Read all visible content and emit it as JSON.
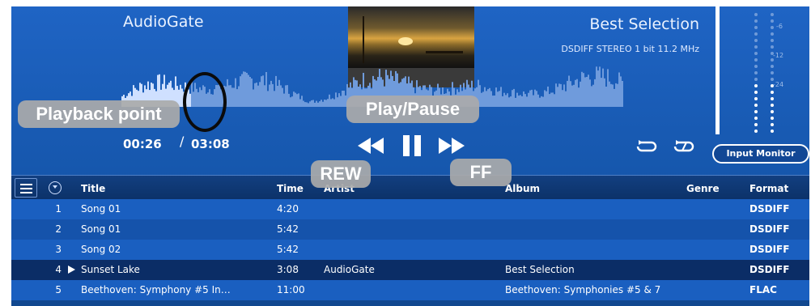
{
  "player": {
    "app_name": "AudioGate",
    "album_title": "Best Selection",
    "format_info": "DSDIFF STEREO 1 bit 11.2 MHz",
    "time_current": "00:26",
    "time_separator": "/",
    "time_total": "03:08",
    "input_monitor_label": "Input Monitor",
    "playback_progress": 0.14,
    "level_meter": {
      "labels": [
        "-6",
        "-12",
        "-24"
      ]
    }
  },
  "callouts": {
    "playback_point": "Playback point",
    "play_pause": "Play/Pause",
    "rew": "REW",
    "ff": "FF"
  },
  "icons": {
    "menu": "menu-icon",
    "sort": "sort-icon",
    "rewind": "rewind-icon",
    "pause": "pause-icon",
    "fast_forward": "fast-forward-icon",
    "repeat": "repeat-icon",
    "repeat_one": "repeat-one-icon",
    "now_playing": "play-marker-icon"
  },
  "table": {
    "headers": {
      "title": "Title",
      "time": "Time",
      "artist": "Artist",
      "album": "Album",
      "genre": "Genre",
      "format": "Format"
    },
    "rows": [
      {
        "num": "1",
        "title": "Song 01",
        "time": "4:20",
        "artist": "",
        "album": "",
        "genre": "",
        "format": "DSDIFF"
      },
      {
        "num": "2",
        "title": "Song 01",
        "time": "5:42",
        "artist": "",
        "album": "",
        "genre": "",
        "format": "DSDIFF"
      },
      {
        "num": "3",
        "title": "Song 02",
        "time": "5:42",
        "artist": "",
        "album": "",
        "genre": "",
        "format": "DSDIFF"
      },
      {
        "num": "4",
        "title": "Sunset Lake",
        "time": "3:08",
        "artist": "AudioGate",
        "album": "Best Selection",
        "genre": "",
        "format": "DSDIFF"
      },
      {
        "num": "5",
        "title": "Beethoven: Symphony #5 In…",
        "time": "11:00",
        "artist": "",
        "album": "Beethoven: Symphonies #5 & 7",
        "genre": "",
        "format": "FLAC"
      }
    ]
  },
  "colors": {
    "panel": "#1a5fc0",
    "active_row": "#0b2d66",
    "callout": "#aaaaaa"
  }
}
